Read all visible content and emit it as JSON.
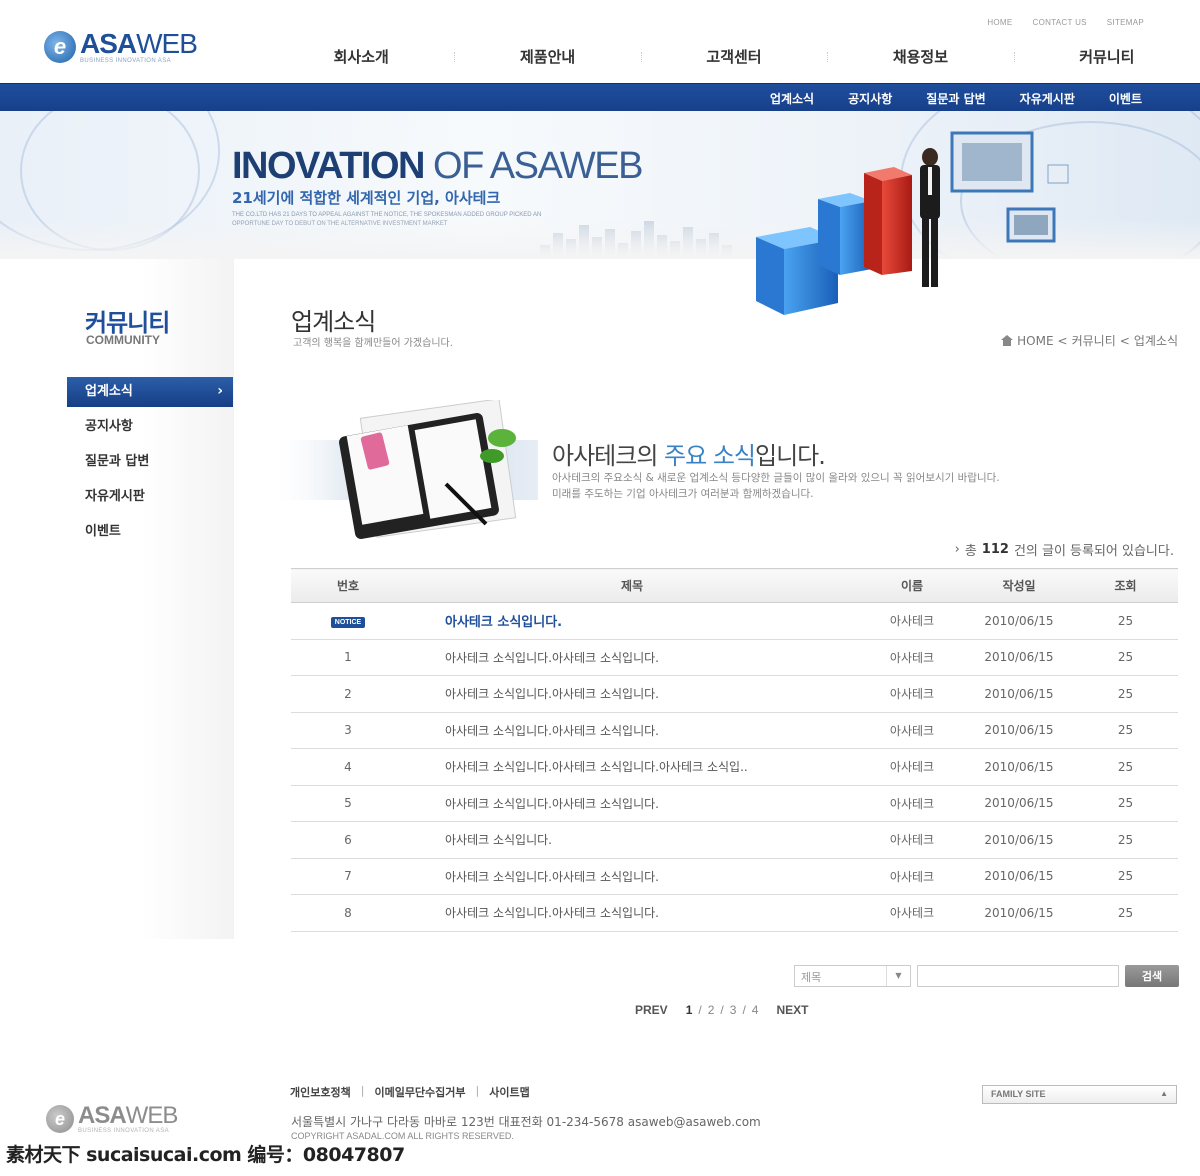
{
  "header": {
    "top_links": [
      "HOME",
      "CONTACT US",
      "SITEMAP"
    ],
    "logo": {
      "name_bold": "ASA",
      "name_light": "WEB",
      "tagline": "BUSINESS INNOVATION ASA"
    },
    "main_nav": [
      "회사소개",
      "제품안내",
      "고객센터",
      "채용정보",
      "커뮤니티"
    ],
    "sub_nav": [
      "업계소식",
      "공지사항",
      "질문과 답변",
      "자유게시판",
      "이벤트"
    ]
  },
  "banner": {
    "title_bold": "INOVATION",
    "title_rest": " OF ASAWEB",
    "subtitle": "21세기에 적합한 세계적인 기업, 아사테크",
    "desc": "THE CO.LTD HAS 21 DAYS TO APPEAL AGAINST THE NOTICE, THE SPOKESMAN ADDED GROUP PICKED AN OPPORTUNE DAY TO DEBUT ON THE ALTERNATIVE INVESTMENT MARKET"
  },
  "sidebar": {
    "title": "커뮤니티",
    "subtitle": "COMMUNITY",
    "items": [
      "업계소식",
      "공지사항",
      "질문과 답변",
      "자유게시판",
      "이벤트"
    ]
  },
  "content": {
    "page_title": "업계소식",
    "page_desc": "고객의 행복을 함께만들어 가겠습니다.",
    "breadcrumb": [
      "HOME",
      "커뮤니티",
      "업계소식"
    ],
    "intro_title_a": "아사테크의 ",
    "intro_title_hl": "주요 소식",
    "intro_title_b": "입니다.",
    "intro_desc_1": "아사테크의 주요소식 & 새로운 업계소식 등다양한 글들이 많이 올라와 있으니 꼭 읽어보시기 바랍니다.",
    "intro_desc_2": "미래를 주도하는 기업 아사테크가 여러분과 함께하겠습니다.",
    "total_prefix": "총",
    "total_count": "112",
    "total_suffix": "건의 글이 등록되어 있습니다."
  },
  "board": {
    "headers": [
      "번호",
      "제목",
      "이름",
      "작성일",
      "조회"
    ],
    "notice": {
      "badge": "NOTICE",
      "title": "아사테크 소식입니다.",
      "name": "아사테크",
      "date": "2010/06/15",
      "views": "25"
    },
    "rows": [
      {
        "no": "1",
        "title": "아사테크 소식입니다.아사테크 소식입니다.",
        "name": "아사테크",
        "date": "2010/06/15",
        "views": "25"
      },
      {
        "no": "2",
        "title": "아사테크 소식입니다.아사테크 소식입니다.",
        "name": "아사테크",
        "date": "2010/06/15",
        "views": "25"
      },
      {
        "no": "3",
        "title": "아사테크 소식입니다.아사테크 소식입니다.",
        "name": "아사테크",
        "date": "2010/06/15",
        "views": "25"
      },
      {
        "no": "4",
        "title": "아사테크 소식입니다.아사테크 소식입니다.아사테크 소식입..",
        "name": "아사테크",
        "date": "2010/06/15",
        "views": "25"
      },
      {
        "no": "5",
        "title": "아사테크 소식입니다.아사테크 소식입니다.",
        "name": "아사테크",
        "date": "2010/06/15",
        "views": "25"
      },
      {
        "no": "6",
        "title": "아사테크 소식입니다.",
        "name": "아사테크",
        "date": "2010/06/15",
        "views": "25"
      },
      {
        "no": "7",
        "title": "아사테크 소식입니다.아사테크 소식입니다.",
        "name": "아사테크",
        "date": "2010/06/15",
        "views": "25"
      },
      {
        "no": "8",
        "title": "아사테크 소식입니다.아사테크 소식입니다.",
        "name": "아사테크",
        "date": "2010/06/15",
        "views": "25"
      }
    ]
  },
  "search": {
    "select_value": "제목",
    "button": "검색",
    "input_value": ""
  },
  "pager": {
    "prev": "PREV",
    "next": "NEXT",
    "pages": [
      "1",
      "2",
      "3",
      "4"
    ],
    "current": "1"
  },
  "footer": {
    "links": [
      "개인보호정책",
      "이메일무단수집거부",
      "사이트맵"
    ],
    "address": "서울특별시 가나구 다라동 마바로 123번   대표전화 01-234-5678   asaweb@asaweb.com",
    "copyright": "COPYRIGHT    ASADAL.COM ALL RIGHTS RESERVED.",
    "family_site": "FAMILY SITE",
    "logo_name_bold": "ASA",
    "logo_name_light": "WEB",
    "logo_tagline": "BUSINESS INNOVATION ASA",
    "watermark": "素材天下 sucaisucai.com  编号：08047807"
  },
  "colors": {
    "brand_navy": "#1f4f9a",
    "accent_blue": "#3b82c4",
    "bar_red": "#c8211f",
    "bar_blue": "#1a6fd0"
  },
  "icons": [
    "home-icon",
    "chevron-right-icon",
    "dropdown-arrow-icon",
    "logo-e-icon"
  ]
}
